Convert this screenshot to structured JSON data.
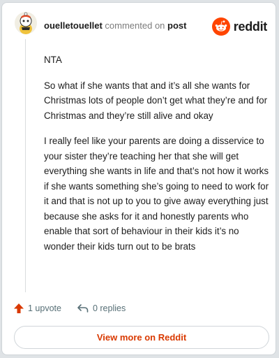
{
  "header": {
    "username": "ouelletouellet",
    "verb": "commented on",
    "link": "post",
    "logo_text": "reddit"
  },
  "comment": {
    "paragraphs": [
      "NTA",
      "So what if she wants that and it’s all she wants for Christmas lots of people don’t get what they’re and for Christmas and they’re still alive and okay",
      "I really feel like your parents are doing a disservice to your sister they’re teaching her that she will get everything she wants in life and that’s not how it works if she wants something she’s going to need to work for it and that is not up to you to give away everything just because she asks for it and honestly parents who enable that sort of behaviour in their kids it’s no wonder their kids turn out to be brats"
    ]
  },
  "actions": {
    "upvote_label": "1 upvote",
    "replies_label": "0 replies"
  },
  "footer": {
    "view_button": "View more on Reddit"
  },
  "colors": {
    "brand": "#ff4500",
    "upvote": "#d93900",
    "button_text": "#d93900"
  },
  "icons": {
    "avatar": "snoo-avatar",
    "logo": "reddit-snoo-icon",
    "upvote": "upvote-arrow-icon",
    "reply": "reply-arrow-icon"
  }
}
